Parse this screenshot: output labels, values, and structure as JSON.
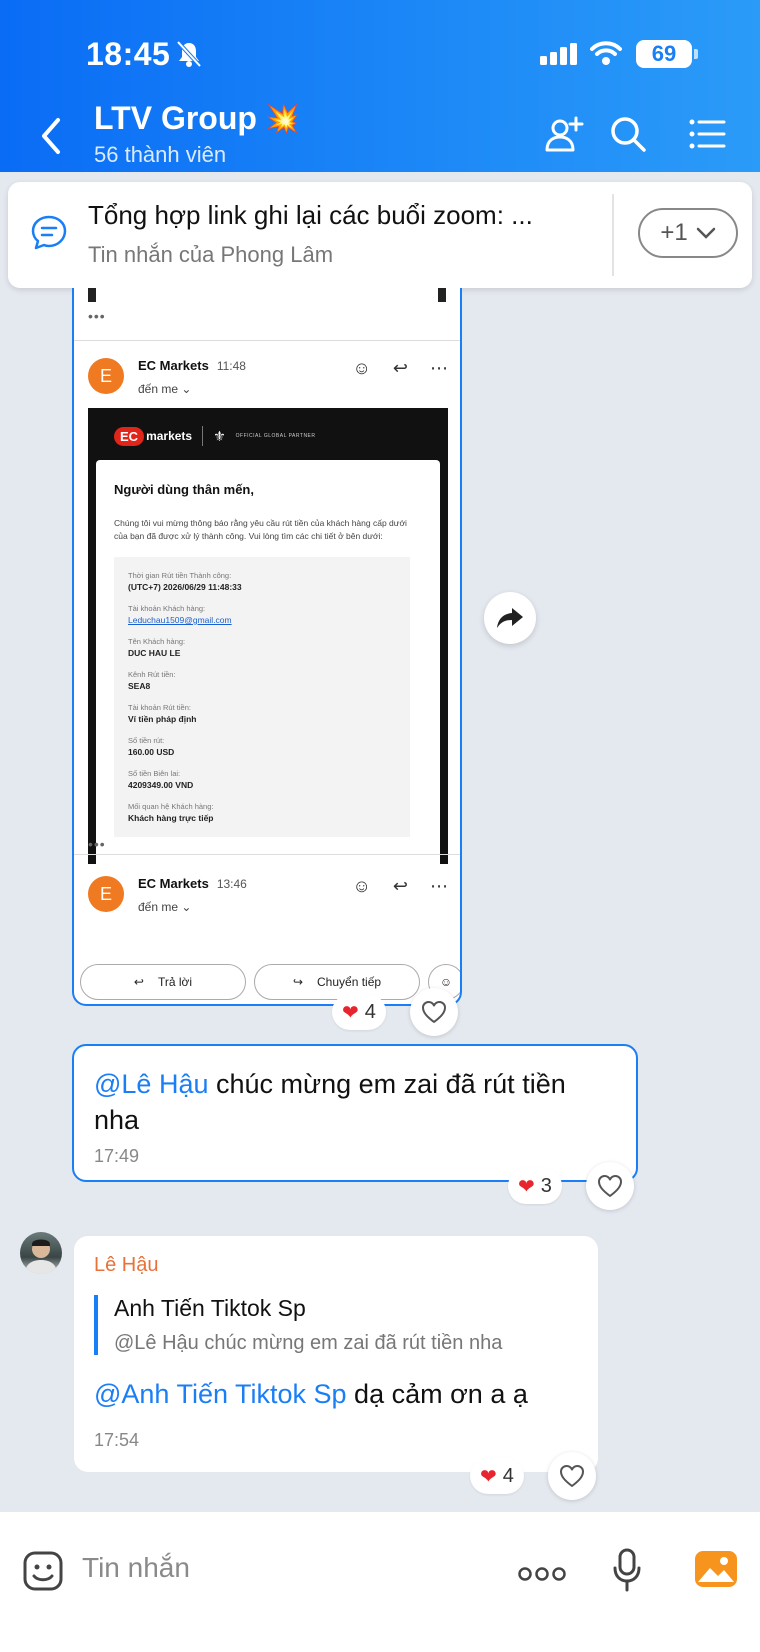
{
  "status": {
    "time": "18:45",
    "battery": "69"
  },
  "header": {
    "title": "LTV Group",
    "emoji": "💥",
    "members": "56 thành viên"
  },
  "pinned": {
    "title": "Tổng hợp link ghi lại các buổi zoom: ...",
    "subtitle": "Tin nhắn của Phong Lâm",
    "more": "+1"
  },
  "email": {
    "first": {
      "avatar": "E",
      "sender": "EC Markets",
      "time": "11:48",
      "to": "đến me ⌄"
    },
    "second": {
      "avatar": "E",
      "sender": "EC Markets",
      "time": "13:46",
      "to": "đến me ⌄"
    },
    "logo_text": "markets",
    "logo_badge": "EC",
    "partner": "OFFICIAL GLOBAL PARTNER",
    "greeting": "Người dùng thân mến,",
    "body": "Chúng tôi vui mừng thông báo rằng yêu cầu rút tiền của khách hàng cấp dưới của bạn đã được xử lý thành công. Vui lòng tìm các chi tiết ở bên dưới:",
    "details": [
      {
        "label": "Thời gian Rút tiền Thành công:",
        "value": "(UTC+7) 2026/06/29 11:48:33"
      },
      {
        "label": "Tài khoản Khách hàng:",
        "value": "Leduchau1509@gmail.com"
      },
      {
        "label": "Tên Khách hàng:",
        "value": "DUC HAU LE"
      },
      {
        "label": "Kênh Rút tiền:",
        "value": "SEA8"
      },
      {
        "label": "Tài khoản Rút tiền:",
        "value": "Ví tiền pháp định"
      },
      {
        "label": "Số tiền rút:",
        "value": "160.00 USD"
      },
      {
        "label": "Số tiền Biên lai:",
        "value": "4209349.00 VND"
      },
      {
        "label": "Mối quan hệ Khách hàng:",
        "value": "Khách hàng trực tiếp"
      }
    ],
    "reply_label": "Trả lời",
    "forward_label": "Chuyển tiếp"
  },
  "reactions": {
    "image_count": "4",
    "sent_count": "3",
    "received_count": "4"
  },
  "sent_message": {
    "mention": "@Lê Hậu",
    "text": "  chúc mừng em zai đã rút tiền nha",
    "time": "17:49"
  },
  "received_message": {
    "sender": "Lê Hậu",
    "quote_title": "Anh Tiến Tiktok Sp",
    "quote_text": "@Lê Hậu  chúc mừng em zai đã rút tiền nha",
    "mention": "@Anh Tiến Tiktok Sp",
    "text": " dạ cảm ơn a ạ",
    "time": "17:54"
  },
  "input": {
    "placeholder": "Tin nhắn"
  },
  "colors": {
    "header_blue": "#1a7ef6",
    "heart_red": "#e8252f",
    "sender_orange": "#e8723a"
  }
}
